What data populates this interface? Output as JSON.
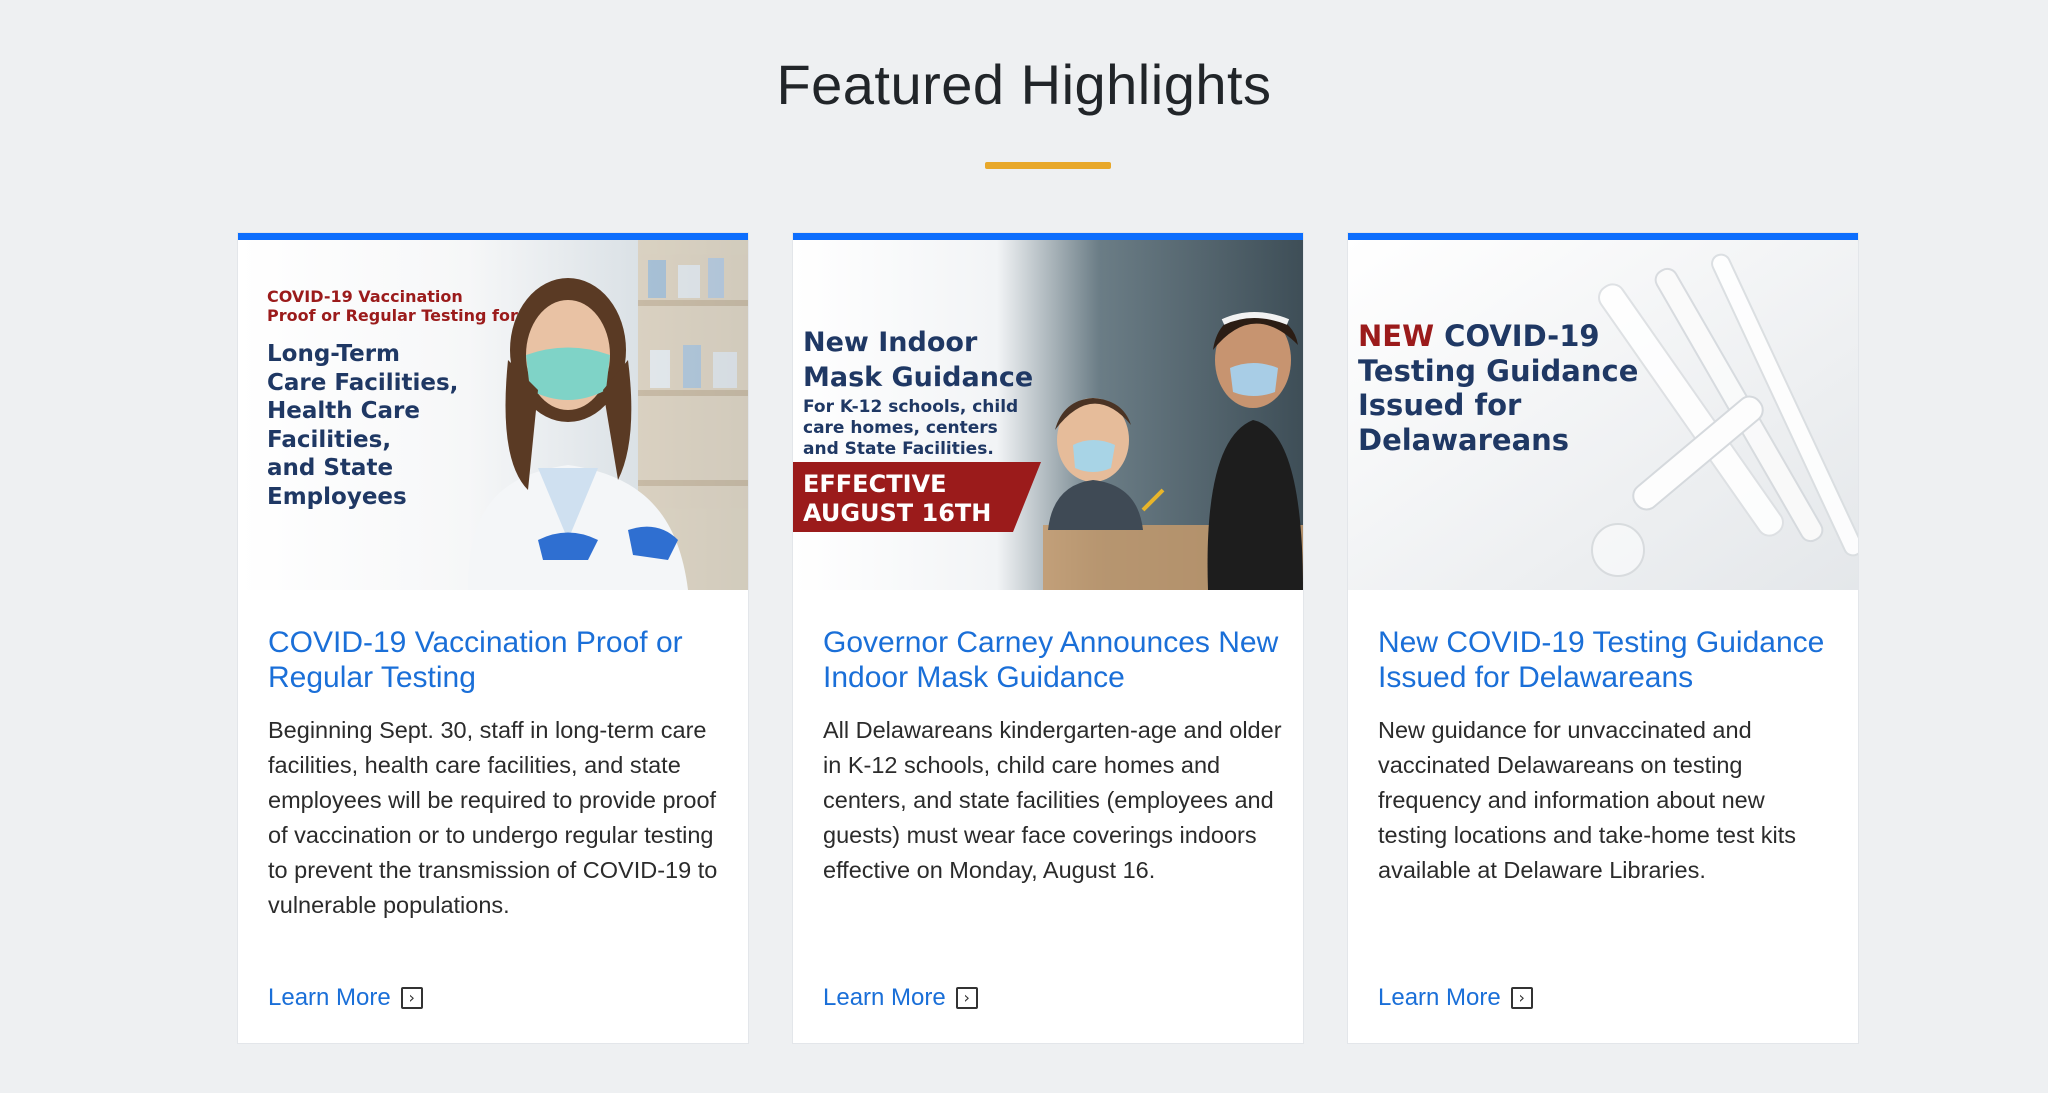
{
  "section": {
    "title": "Featured Highlights"
  },
  "colors": {
    "accent_blue": "#0d6efd",
    "link_blue": "#1a6fd8",
    "underline_gold": "#e8a82a",
    "banner_red": "#9b1b1b",
    "navy_text": "#1f3864"
  },
  "cards": [
    {
      "image": {
        "intro_line1": "COVID-19 Vaccination",
        "intro_line2": "Proof or Regular Testing for",
        "head_line1": "Long-Term",
        "head_line2": "Care Facilities,",
        "head_line3": "Health Care",
        "head_line4": "Facilities,",
        "head_line5": "and State",
        "head_line6": "Employees"
      },
      "title": "COVID-19 Vaccination Proof or Regular Testing",
      "description": "Beginning Sept. 30, staff in long-term care facilities, health care facilities, and state employees will be required to provide proof of vaccination or to undergo regular testing to prevent the transmission of COVID-19 to vulnerable populations.",
      "link_label": "Learn More",
      "link_icon": "external-link-icon"
    },
    {
      "image": {
        "head_line1": "New Indoor",
        "head_line2": "Mask Guidance",
        "sub_line1": "For K-12 schools, child",
        "sub_line2": "care homes, centers",
        "sub_line3": "and State Facilities.",
        "banner_line1": "EFFECTIVE",
        "banner_line2": "AUGUST 16TH"
      },
      "title": "Governor Carney Announces New Indoor Mask Guidance",
      "description": "All Delawareans kindergarten-age and older in K-12 schools, child care homes and centers, and state facilities (employees and guests) must wear face coverings indoors effective on Monday, August 16.",
      "link_label": "Learn More",
      "link_icon": "external-link-icon"
    },
    {
      "image": {
        "new_word": "NEW",
        "head_line1_rest": " COVID-19",
        "head_line2": "Testing Guidance",
        "head_line3": "Issued for",
        "head_line4": "Delawareans"
      },
      "title": "New COVID-19 Testing Guidance Issued for Delawareans",
      "description": "New guidance for unvaccinated and vaccinated Delawareans on testing frequency and information about new testing locations and take-home test kits available at Delaware Libraries.",
      "link_label": "Learn More",
      "link_icon": "external-link-icon"
    }
  ]
}
